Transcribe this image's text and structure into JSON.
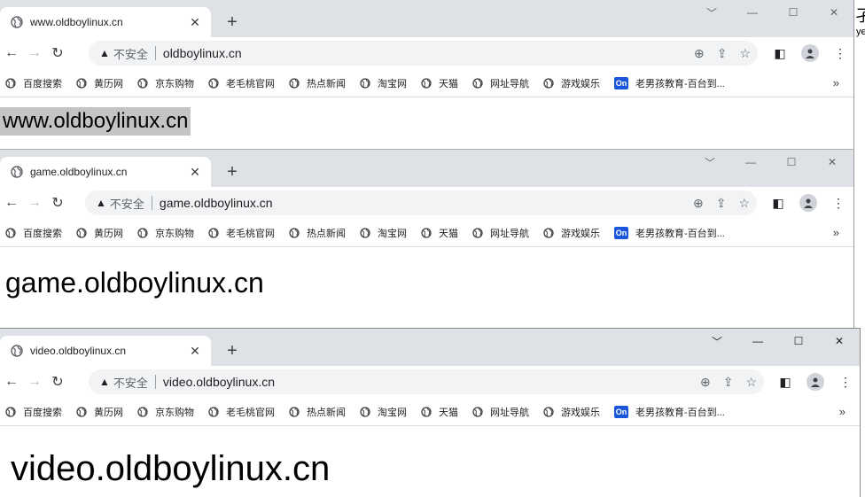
{
  "windows": [
    {
      "tab_title": "www.oldboylinux.cn",
      "security_label": "不安全",
      "url": "oldboylinux.cn",
      "page_text": "www.oldboylinux.cn"
    },
    {
      "tab_title": "game.oldboylinux.cn",
      "security_label": "不安全",
      "url": "game.oldboylinux.cn",
      "page_text": "game.oldboylinux.cn"
    },
    {
      "tab_title": "video.oldboylinux.cn",
      "security_label": "不安全",
      "url": "video.oldboylinux.cn",
      "page_text": "video.oldboylinux.cn"
    }
  ],
  "bookmarks": [
    {
      "label": "百度搜索",
      "icon": "globe-icon"
    },
    {
      "label": "黄历网",
      "icon": "globe-icon"
    },
    {
      "label": "京东购物",
      "icon": "globe-icon"
    },
    {
      "label": "老毛桃官网",
      "icon": "globe-icon"
    },
    {
      "label": "热点新闻",
      "icon": "globe-icon"
    },
    {
      "label": "淘宝网",
      "icon": "globe-icon"
    },
    {
      "label": "天猫",
      "icon": "globe-icon"
    },
    {
      "label": "网址导航",
      "icon": "globe-icon"
    },
    {
      "label": "游戏娱乐",
      "icon": "globe-icon"
    },
    {
      "label": "老男孩教育-百台到...",
      "icon": "on-badge"
    }
  ],
  "on_badge_text": "On",
  "edge_partial": {
    "glyph": "孑",
    "text": "ye"
  }
}
